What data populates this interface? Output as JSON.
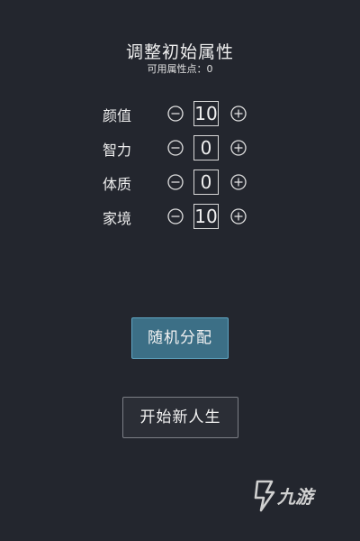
{
  "header": {
    "title": "调整初始属性",
    "available_points_label": "可用属性点：",
    "available_points_value": "0"
  },
  "attributes": [
    {
      "label": "颜值",
      "value": "10"
    },
    {
      "label": "智力",
      "value": "0"
    },
    {
      "label": "体质",
      "value": "0"
    },
    {
      "label": "家境",
      "value": "10"
    }
  ],
  "actions": {
    "random_label": "随机分配",
    "start_label": "开始新人生"
  },
  "watermark": {
    "text": "九游",
    "icon": "jiuyou-logo-icon"
  },
  "colors": {
    "background": "#23262e",
    "random_button": "#3c6f86",
    "start_button_border": "#7c7f86"
  }
}
